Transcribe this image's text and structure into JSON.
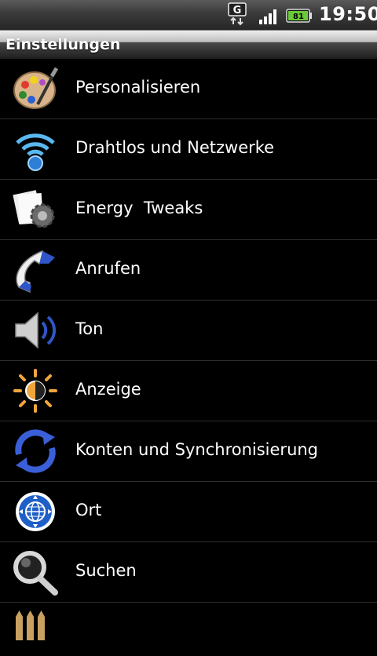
{
  "status_bar": {
    "network_type": "G",
    "battery_level": "81",
    "time": "19:50",
    "icons": [
      "network-g-icon",
      "signal-strength-icon",
      "battery-icon"
    ]
  },
  "header": {
    "title": "Einstellungen"
  },
  "settings": {
    "items": [
      {
        "label": "Personalisieren",
        "icon": "palette-icon"
      },
      {
        "label": "Drahtlos und Netzwerke",
        "icon": "wifi-icon"
      },
      {
        "label": "Energy  Tweaks",
        "icon": "gear-document-icon"
      },
      {
        "label": "Anrufen",
        "icon": "phone-handset-icon"
      },
      {
        "label": "Ton",
        "icon": "speaker-icon"
      },
      {
        "label": "Anzeige",
        "icon": "brightness-icon"
      },
      {
        "label": "Konten und Synchronisierung",
        "icon": "sync-icon"
      },
      {
        "label": "Ort",
        "icon": "globe-location-icon"
      },
      {
        "label": "Suchen",
        "icon": "magnifier-icon"
      },
      {
        "label": "",
        "icon": "privacy-icon"
      }
    ]
  },
  "colors": {
    "background": "#000000",
    "divider": "#2e2e2e",
    "text": "#ffffff",
    "accent_blue": "#2f6fd6",
    "accent_orange": "#f0a63c"
  }
}
